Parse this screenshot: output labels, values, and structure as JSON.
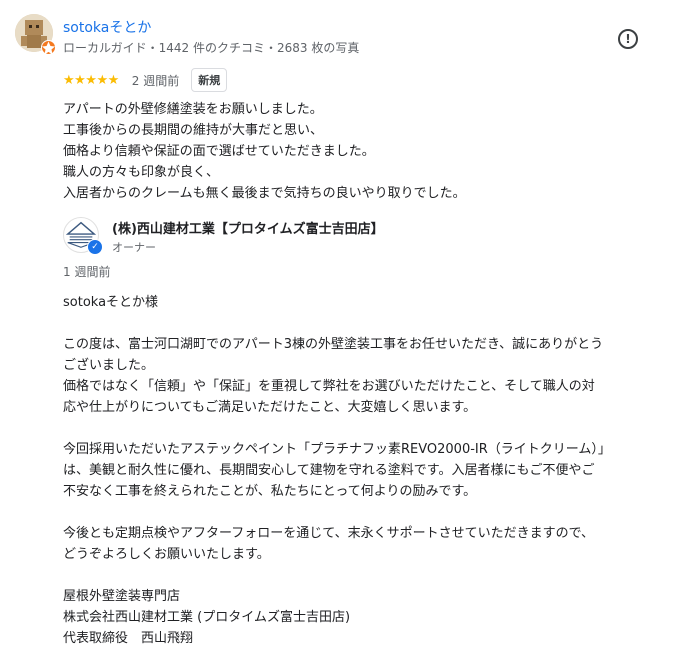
{
  "reviewer": {
    "name": "sotokaそとか",
    "meta": "ローカルガイド・1442 件のクチコミ・2683 枚の写真",
    "avatar_icon": "user-avatar",
    "badge_icon": "local-guide-badge-icon"
  },
  "review": {
    "rating": 5,
    "stars": "★★★★★",
    "time": "2 週間前",
    "badge": "新規",
    "lines": [
      "アパートの外壁修繕塗装をお願いしました。",
      "工事後からの長期間の維持が大事だと思い、",
      "価格より信頼や保証の面で選ばせていただきました。",
      "職人の方々も印象が良く、",
      "入居者からのクレームも無く最後まで気持ちの良いやり取りでした。"
    ]
  },
  "owner": {
    "name": "(株)西山建材工業【プロタイムズ富士吉田店】",
    "role": "オーナー",
    "reply_time": "1 週間前",
    "verified_icon": "verified-check-icon",
    "reply_lines": [
      "sotokaそとか様",
      "",
      "この度は、富士河口湖町でのアパート3棟の外壁塗装工事をお任せいただき、誠にありがとう",
      "ございました。",
      "価格ではなく「信頼」や「保証」を重視して弊社をお選びいただけたこと、そして職人の対",
      "応や仕上がりについてもご満足いただけたこと、大変嬉しく思います。",
      "",
      "今回採用いただいたアステックペイント「プラチナフッ素REVO2000-IR（ライトクリーム）」",
      "は、美観と耐久性に優れ、長期間安心して建物を守れる塗料です。入居者様にもご不便やご",
      "不安なく工事を終えられたことが、私たちにとって何よりの励みです。",
      "",
      "今後とも定期点検やアフターフォローを通じて、末永くサポートさせていただきますので、",
      "どうぞよろしくお願いいたします。",
      "",
      "屋根外壁塗装専門店",
      "株式会社西山建材工業 (プロタイムズ富士吉田店)",
      "代表取締役　西山飛翔"
    ]
  },
  "actions": {
    "report_icon": "report-icon",
    "report_glyph": "!"
  },
  "colors": {
    "link": "#1a73e8",
    "star": "#fbbc04",
    "secondary_text": "#5f6368",
    "guide_badge": "#f4791f"
  }
}
